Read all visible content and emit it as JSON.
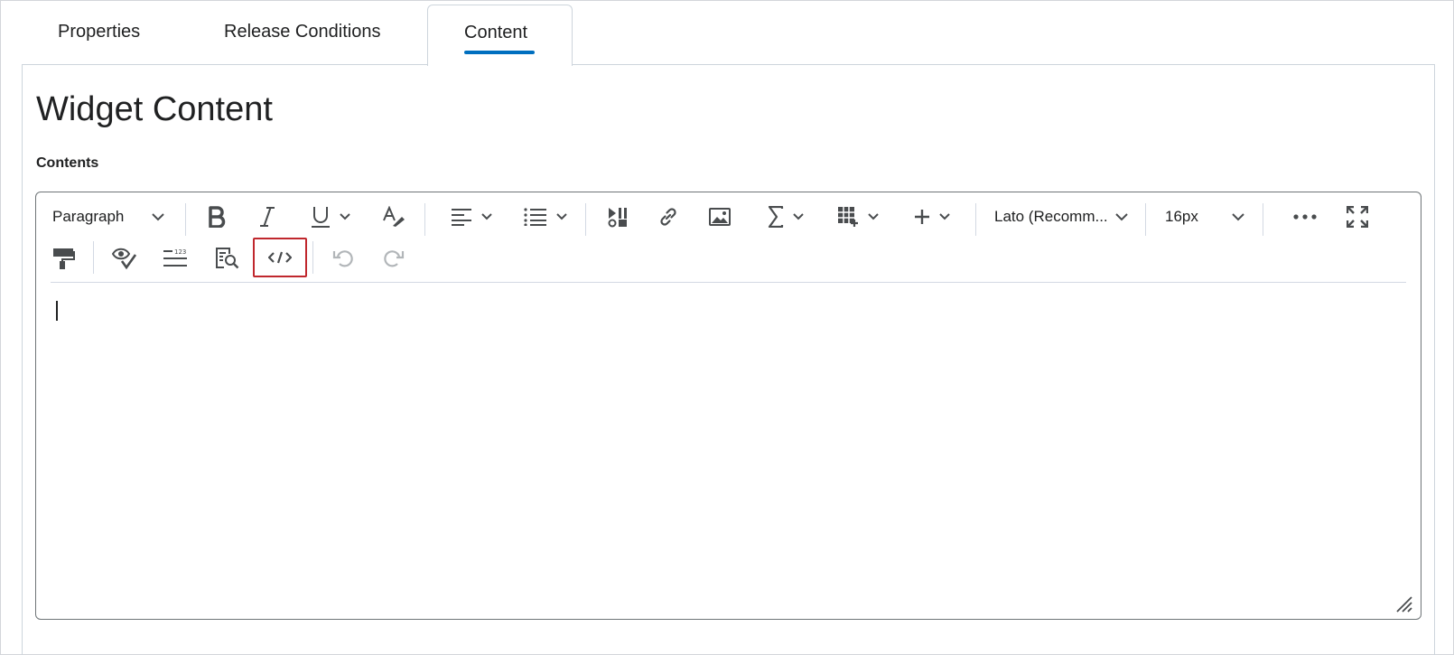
{
  "tabs": {
    "properties": "Properties",
    "release_conditions": "Release Conditions",
    "content": "Content"
  },
  "panel": {
    "title": "Widget Content",
    "contents_label": "Contents"
  },
  "toolbar": {
    "block_format": "Paragraph",
    "font_family": "Lato (Recomm...",
    "font_size": "16px",
    "buttons_row1": [
      "block-format",
      "bold",
      "italic",
      "underline",
      "format-painter-clear",
      "align",
      "list",
      "insert-stuff",
      "link",
      "image",
      "equation",
      "table",
      "insert",
      "font-family",
      "font-size",
      "more",
      "fullscreen"
    ],
    "buttons_row2": [
      "format-painter",
      "accessibility-checker",
      "word-count",
      "preview",
      "source-code",
      "undo",
      "redo"
    ]
  },
  "highlight": {
    "target": "source-code-button",
    "color": "#c0272d"
  },
  "colors": {
    "accent": "#006fbf",
    "icon": "#494c4e",
    "border": "#6e7477"
  }
}
